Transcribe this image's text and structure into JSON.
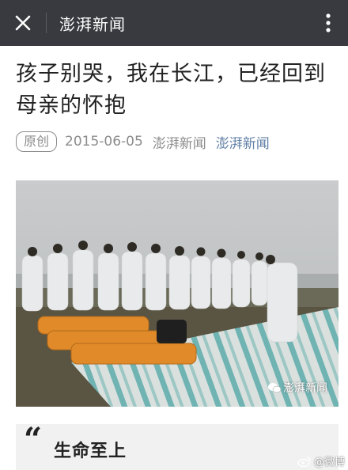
{
  "appbar": {
    "title": "澎湃新闻",
    "close_icon": "close-icon",
    "more_icon": "more-vertical-icon",
    "bg_color": "#393a3f"
  },
  "article": {
    "headline": "孩子别哭，我在长江，已经回到母亲的怀抱",
    "badge": "原创",
    "date": "2015-06-05",
    "author": "澎湃新闻",
    "account": "澎湃新闻",
    "account_color": "#607fa6",
    "photo_watermark": "澎湃新闻",
    "quote_heading": "生命至上"
  },
  "overlay": {
    "weibo_watermark": "@微博"
  }
}
